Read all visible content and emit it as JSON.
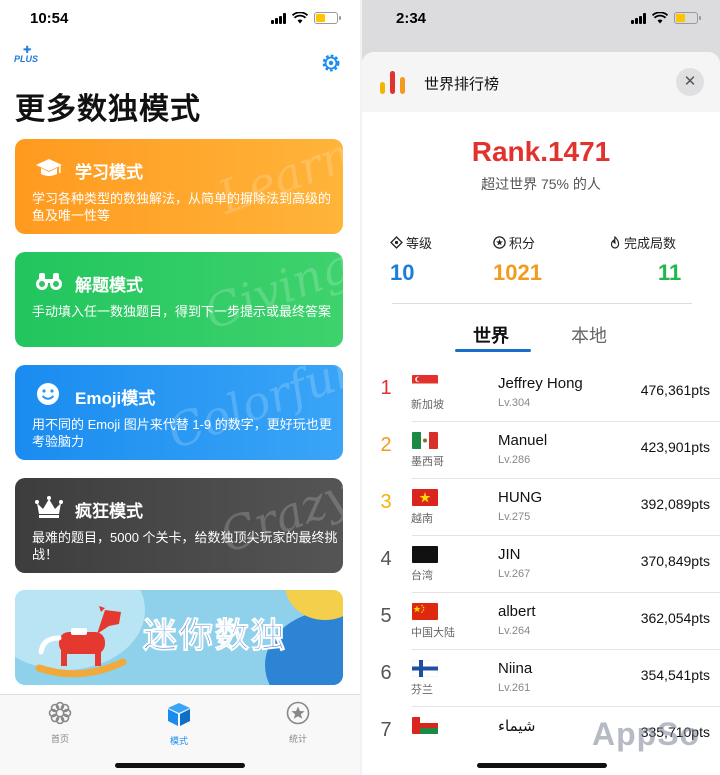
{
  "left": {
    "status": {
      "time": "10:54"
    },
    "logo": "PLUS",
    "title": "更多数独模式",
    "modes": [
      {
        "title": "学习模式",
        "desc": "学习各种类型的数独解法，从简单的摒除法到高级的鱼及唯一性等",
        "bg_word": "Learn",
        "icon": "graduation-cap-icon"
      },
      {
        "title": "解题模式",
        "desc": "手动填入任一数独题目，得到下一步提示或最终答案",
        "bg_word": "Giving",
        "icon": "binoculars-icon"
      },
      {
        "title": "Emoji模式",
        "desc": "用不同的 Emoji 图片来代替 1-9 的数字，更好玩也更考验脑力",
        "bg_word": "Colorful",
        "icon": "smiley-icon"
      },
      {
        "title": "疯狂模式",
        "desc": "最难的题目，5000 个关卡，给数独顶尖玩家的最终挑战！",
        "bg_word": "Crazy",
        "icon": "crown-icon"
      }
    ],
    "banner": {
      "text": "迷你数独"
    },
    "tabs": [
      {
        "label": "首页"
      },
      {
        "label": "模式"
      },
      {
        "label": "统计"
      }
    ]
  },
  "right": {
    "status": {
      "time": "2:34"
    },
    "sheet_title": "世界排行榜",
    "rank": "Rank.1471",
    "rank_sub": "超过世界 75% 的人",
    "stats": [
      {
        "label": "等级",
        "value": "10",
        "color": "#1a7fd6"
      },
      {
        "label": "积分",
        "value": "1021",
        "color": "#f39b1f"
      },
      {
        "label": "完成局数",
        "value": "11",
        "color": "#1fb84a"
      }
    ],
    "segments": {
      "world": "世界",
      "local": "本地"
    },
    "rank_colors": {
      "gold": "#e1322d",
      "silver": "#f39b1f",
      "bronze": "#f2b500",
      "default": "#555555"
    },
    "players": [
      {
        "rank": "1",
        "country": "新加坡",
        "name": "Jeffrey Hong",
        "level": "Lv.304",
        "points": "476,361pts"
      },
      {
        "rank": "2",
        "country": "墨西哥",
        "name": "Manuel",
        "level": "Lv.286",
        "points": "423,901pts"
      },
      {
        "rank": "3",
        "country": "越南",
        "name": "HUNG",
        "level": "Lv.275",
        "points": "392,089pts"
      },
      {
        "rank": "4",
        "country": "台湾",
        "name": "JIN",
        "level": "Lv.267",
        "points": "370,849pts"
      },
      {
        "rank": "5",
        "country": "中国大陆",
        "name": "albert",
        "level": "Lv.264",
        "points": "362,054pts"
      },
      {
        "rank": "6",
        "country": "芬兰",
        "name": "Niina",
        "level": "Lv.261",
        "points": "354,541pts"
      },
      {
        "rank": "7",
        "country": "",
        "name": "شيماء",
        "level": "",
        "points": "335,710pts"
      }
    ],
    "watermark": "AppSo"
  }
}
